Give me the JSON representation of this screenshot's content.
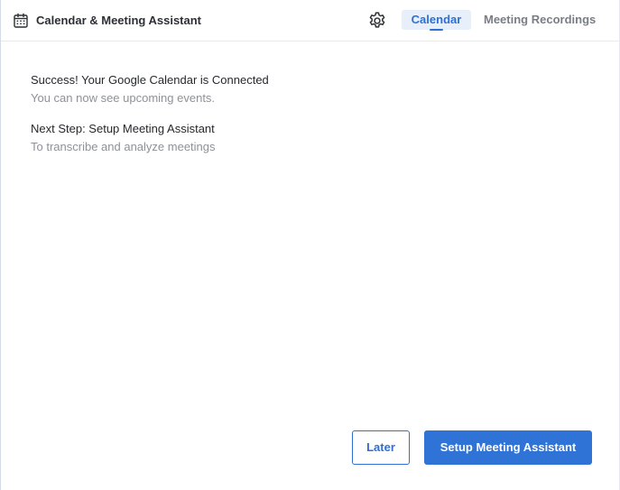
{
  "header": {
    "app_title": "Calendar & Meeting Assistant",
    "app_icon": "calendar-icon",
    "settings_icon": "gear-icon",
    "tabs": [
      {
        "label": "Calendar",
        "active": true
      },
      {
        "label": "Meeting Recordings",
        "active": false
      }
    ]
  },
  "main": {
    "messages": [
      {
        "title": "Success! Your Google Calendar is Connected",
        "subtitle": "You can now see upcoming events."
      },
      {
        "title": "Next Step: Setup Meeting Assistant",
        "subtitle": "To transcribe and analyze meetings"
      }
    ]
  },
  "actions": {
    "later_label": "Later",
    "setup_label": "Setup Meeting Assistant"
  },
  "colors": {
    "accent": "#2e6fd3",
    "active_tab_bg": "#e7effb",
    "inactive_tab_text": "#7a7d85",
    "primary_text": "#26282c",
    "secondary_text": "#8e9197"
  }
}
